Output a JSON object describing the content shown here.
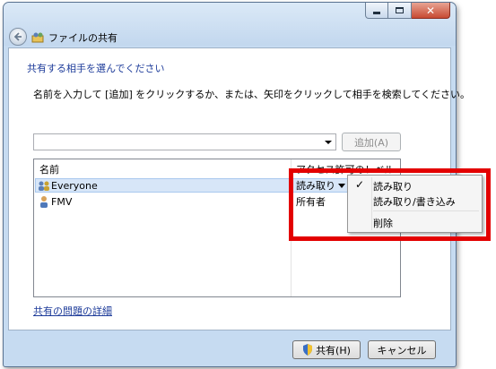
{
  "window": {
    "title": "ファイルの共有"
  },
  "dialog": {
    "heading": "共有する相手を選んでください",
    "instruction": "名前を入力して [追加] をクリックするか、または、矢印をクリックして相手を検索してください。",
    "name_input_value": "",
    "add_button_label": "追加(A)",
    "details_link": "共有の問題の詳細",
    "share_button_label": "共有(H)",
    "cancel_button_label": "キャンセル"
  },
  "list": {
    "columns": [
      "名前",
      "アクセス許可のレベル"
    ],
    "rows": [
      {
        "name": "Everyone",
        "access": "読み取り",
        "icon": "users-group-icon"
      },
      {
        "name": "FMV",
        "access": "所有者",
        "icon": "user-icon"
      }
    ]
  },
  "context_menu": {
    "items": [
      {
        "label": "読み取り",
        "checked": true
      },
      {
        "label": "読み取り/書き込み",
        "checked": false
      },
      {
        "label": "削除",
        "checked": false
      }
    ]
  },
  "colors": {
    "highlight_frame": "#e30000",
    "link": "#1e3c9a",
    "selected_row": "#d7e6f8"
  }
}
